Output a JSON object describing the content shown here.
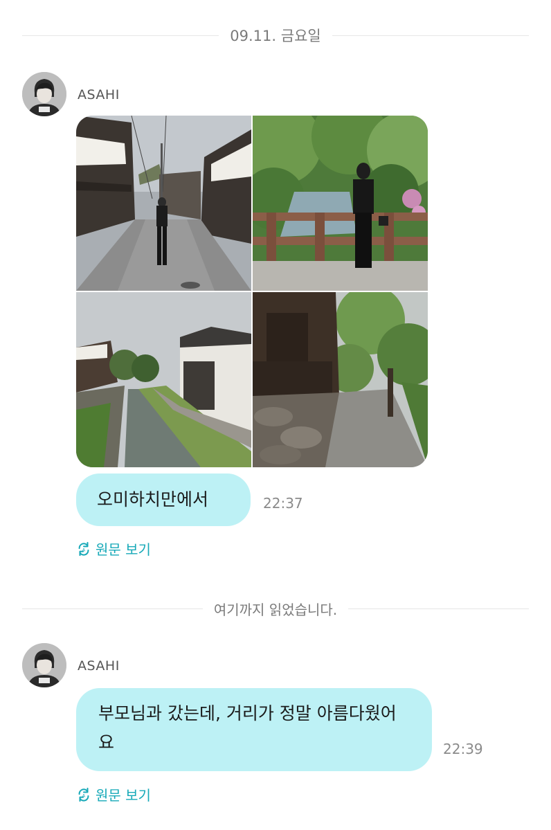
{
  "chat": {
    "date_divider": "09.11. 금요일",
    "read_marker": "여기까지 읽었습니다.",
    "messages": [
      {
        "sender": "ASAHI",
        "photo_count": 4,
        "text": "오미하치만에서",
        "time": "22:37",
        "translate_label": "원문 보기"
      },
      {
        "sender": "ASAHI",
        "text": "부모님과 갔는데, 거리가 정말 아름다웠어요",
        "time": "22:39",
        "translate_label": "원문 보기"
      }
    ]
  },
  "icons": {
    "translate": "translate-refresh-icon",
    "avatar": "user-avatar"
  },
  "colors": {
    "bubble": "#bdf1f5",
    "accent": "#17a9b8",
    "muted_text": "#8a8a8a",
    "divider_line": "#e6e6e6"
  }
}
